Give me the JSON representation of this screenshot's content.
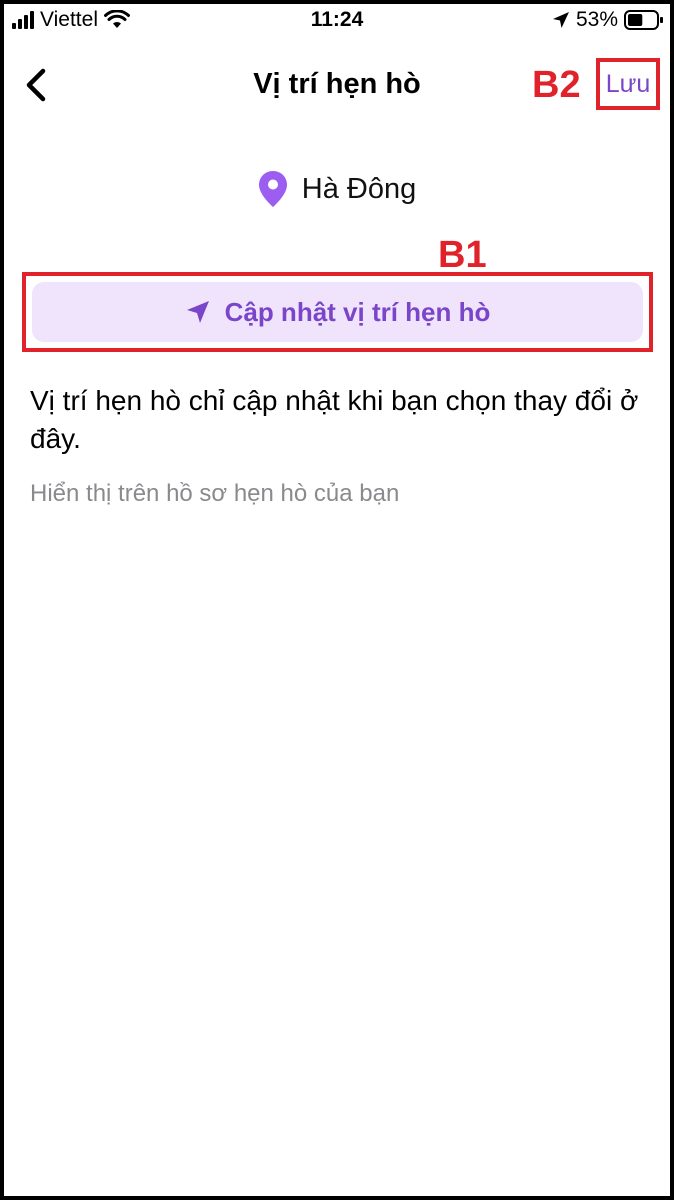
{
  "status_bar": {
    "carrier": "Viettel",
    "time": "11:24",
    "battery_percent": "53%",
    "battery_level": 0.53
  },
  "nav": {
    "title": "Vị trí hẹn hò",
    "save_label": "Lưu",
    "back_icon": "chevron-left-icon"
  },
  "annotations": {
    "b1": "B1",
    "b2": "B2",
    "color": "#e0232a"
  },
  "location": {
    "name": "Hà Đông",
    "icon": "map-pin-icon"
  },
  "update_button": {
    "label": "Cập nhật vị trí hẹn hò",
    "icon": "navigation-arrow-icon"
  },
  "info": {
    "text": "Vị trí hẹn hò chỉ cập nhật khi bạn chọn thay đổi ở đây.",
    "subtext": "Hiển thị trên hồ sơ hẹn hò của bạn"
  },
  "colors": {
    "accent": "#7b45c9",
    "button_bg": "#efe4fb"
  }
}
